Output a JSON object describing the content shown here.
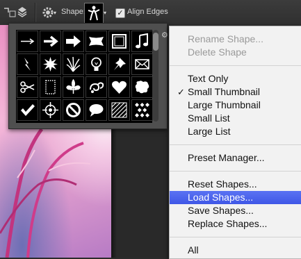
{
  "options_bar": {
    "shape_label": "Shape:",
    "align_edges_label": "Align Edges",
    "align_edges_checked": "✓"
  },
  "shape_picker": {
    "shapes": [
      "arrow-thin-icon",
      "arrow-bold-icon",
      "arrow-block-icon",
      "banner-icon",
      "square-frame-icon",
      "music-note-icon",
      "lightning-icon",
      "starburst-icon",
      "grass-icon",
      "lightbulb-icon",
      "pushpin-icon",
      "envelope-icon",
      "scissors-icon",
      "stamp-frame-icon",
      "fleur-de-lis-icon",
      "ornament-icon",
      "heart-icon",
      "puzzle-blob-icon",
      "checkmark-icon",
      "crosshair-icon",
      "no-sign-icon",
      "speech-bubble-icon",
      "hatch-square-icon",
      "diamond-grid-icon"
    ]
  },
  "menu": {
    "rename": "Rename Shape...",
    "delete": "Delete Shape",
    "text_only": "Text Only",
    "small_thumb": "Small Thumbnail",
    "large_thumb": "Large Thumbnail",
    "small_list": "Small List",
    "large_list": "Large List",
    "preset_manager": "Preset Manager...",
    "reset": "Reset Shapes...",
    "load": "Load Shapes...",
    "save": "Save Shapes...",
    "replace": "Replace Shapes...",
    "all": "All",
    "checked_item_mark": "✓"
  },
  "colors": {
    "menu_highlight": "#4a63ee",
    "photo_pink": "#e98fc2"
  }
}
